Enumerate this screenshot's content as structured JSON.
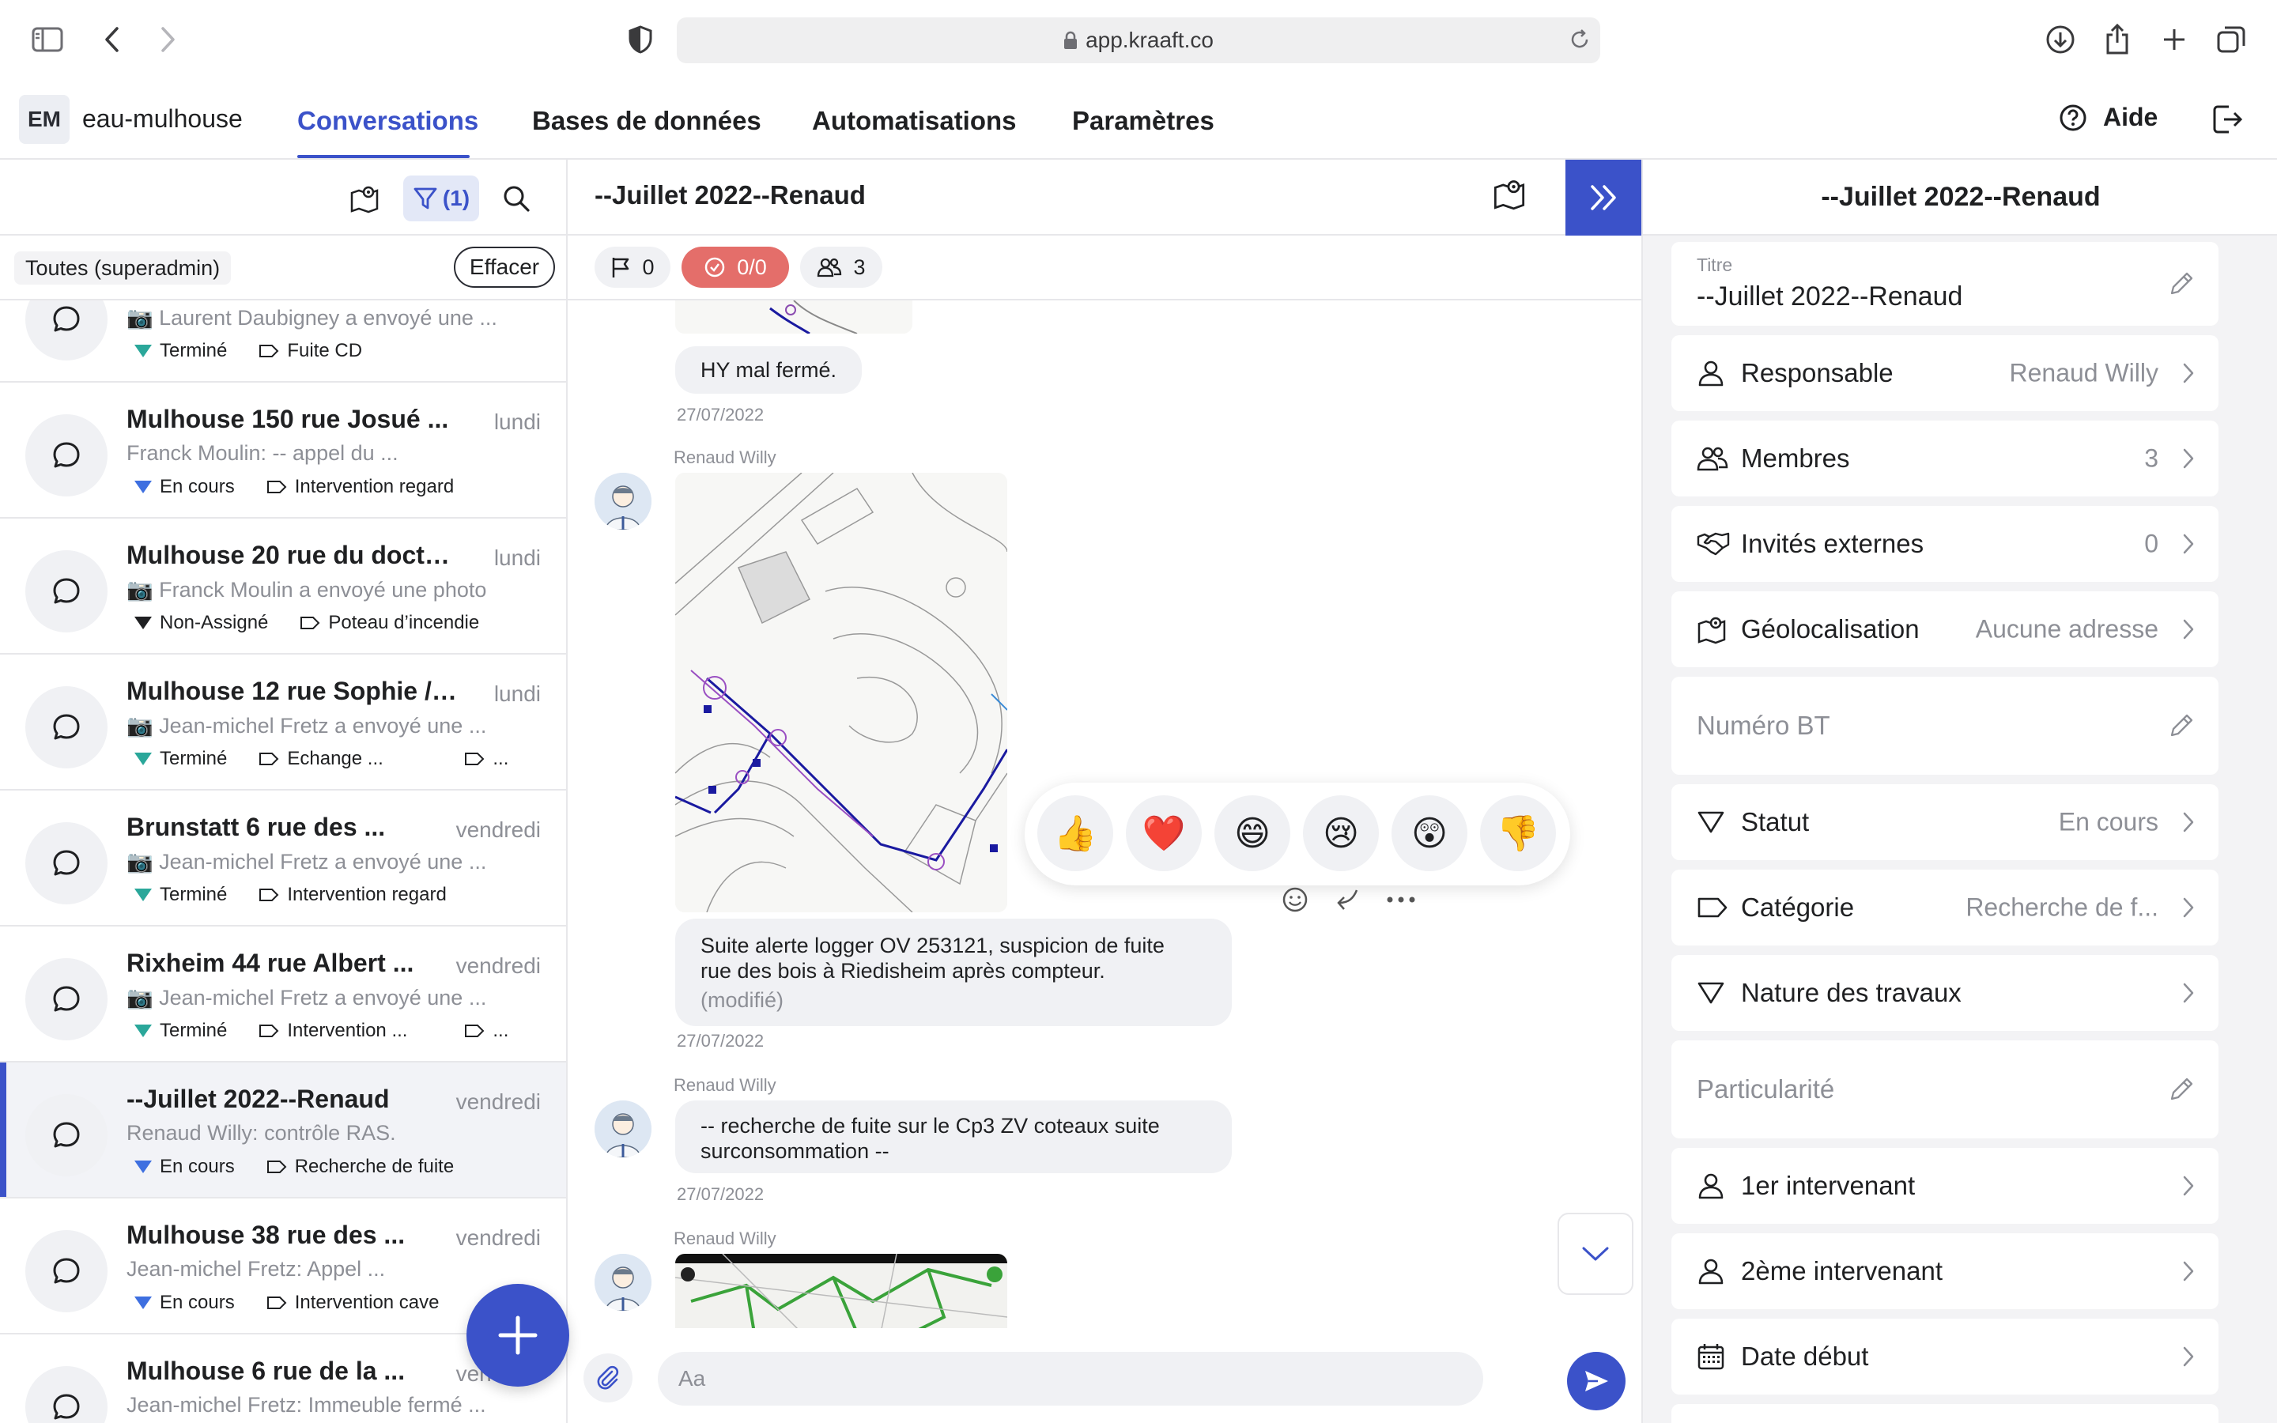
{
  "browser": {
    "url": "app.kraaft.co"
  },
  "nav": {
    "workspace_initials": "EM",
    "workspace_name": "eau-mulhouse",
    "tabs": [
      "Conversations",
      "Bases de données",
      "Automatisations",
      "Paramètres"
    ],
    "active_tab": "Conversations",
    "help_label": "Aide"
  },
  "left": {
    "filter_count": "(1)",
    "filter_label": "Toutes (superadmin)",
    "clear_label": "Effacer",
    "conversations": [
      {
        "title": "",
        "date": "",
        "preview": "📷 Laurent Daubigney a envoyé une ...",
        "status": "Terminé",
        "status_color": "#2aa79a",
        "tags": [
          "Fuite CD"
        ]
      },
      {
        "title": "Mulhouse 150 rue Josué ...",
        "date": "lundi",
        "preview": "Franck Moulin: -- appel du ...",
        "status": "En cours",
        "status_color": "#3e6fe0",
        "tags": [
          "Intervention regard"
        ]
      },
      {
        "title": "Mulhouse 20 rue du docte...",
        "date": "lundi",
        "preview": "📷 Franck Moulin a envoyé une photo",
        "status": "Non-Assigné",
        "status_color": "#1f2022",
        "tags": [
          "Poteau d’incendie"
        ]
      },
      {
        "title": "Mulhouse 12 rue Sophie / ...",
        "date": "lundi",
        "preview": "📷 Jean-michel Fretz a envoyé une ...",
        "status": "Terminé",
        "status_color": "#2aa79a",
        "tags": [
          "Echange ...",
          "..."
        ]
      },
      {
        "title": "Brunstatt 6 rue des ...",
        "date": "vendredi",
        "preview": "📷 Jean-michel Fretz a envoyé une ...",
        "status": "Terminé",
        "status_color": "#2aa79a",
        "tags": [
          "Intervention regard"
        ]
      },
      {
        "title": "Rixheim 44 rue Albert ...",
        "date": "vendredi",
        "preview": "📷 Jean-michel Fretz a envoyé une ...",
        "status": "Terminé",
        "status_color": "#2aa79a",
        "tags": [
          "Intervention ...",
          "..."
        ]
      },
      {
        "title": "--Juillet 2022--Renaud",
        "date": "vendredi",
        "preview": "Renaud Willy: contrôle RAS.",
        "status": "En cours",
        "status_color": "#3e6fe0",
        "tags": [
          "Recherche de fuite"
        ]
      },
      {
        "title": "Mulhouse 38 rue des ...",
        "date": "vendredi",
        "preview": "Jean-michel Fretz: Appel ...",
        "status": "En cours",
        "status_color": "#3e6fe0",
        "tags": [
          "Intervention cave"
        ]
      },
      {
        "title": "Mulhouse 6 rue de la ...",
        "date": "vendredi",
        "preview": "Jean-michel Fretz: Immeuble fermé ...",
        "status": "",
        "status_color": "#3e6fe0",
        "tags": []
      }
    ]
  },
  "mid": {
    "title": "--Juillet 2022--Renaud",
    "chips": {
      "flags": "0",
      "tasks": "0/0",
      "members": "3"
    },
    "messages": {
      "m1_text": "HY mal fermé.",
      "m1_date": "27/07/2022",
      "m2_author": "Renaud Willy",
      "m3_text_1": "Suite alerte logger OV 253121, suspicion de fuite",
      "m3_text_2": "rue des bois à Riedisheim après compteur.",
      "m3_edited": "(modifié)",
      "m3_date": "27/07/2022",
      "m4_author": "Renaud Willy",
      "m4_text_1": "-- recherche de fuite sur le Cp3 ZV coteaux suite",
      "m4_text_2": "surconsommation --",
      "m4_date": "27/07/2022",
      "m5_author": "Renaud Willy"
    },
    "reactions": [
      "👍",
      "❤️",
      "😄",
      "😢",
      "😲",
      "👎"
    ],
    "composer_placeholder": "Aa"
  },
  "right": {
    "header": "--Juillet 2022--Renaud",
    "title_label": "Titre",
    "title_value": "--Juillet 2022--Renaud",
    "fields": {
      "responsable": {
        "label": "Responsable",
        "value": "Renaud Willy"
      },
      "membres": {
        "label": "Membres",
        "value": "3"
      },
      "invites": {
        "label": "Invités externes",
        "value": "0"
      },
      "geo": {
        "label": "Géolocalisation",
        "value": "Aucune adresse"
      },
      "numero_bt": {
        "label": "Numéro BT"
      },
      "statut": {
        "label": "Statut",
        "value": "En cours"
      },
      "categorie": {
        "label": "Catégorie",
        "value": "Recherche de f..."
      },
      "nature": {
        "label": "Nature des travaux",
        "value": ""
      },
      "particularite": {
        "label": "Particularité"
      },
      "intervenant1": {
        "label": "1er intervenant",
        "value": ""
      },
      "intervenant2": {
        "label": "2ème intervenant",
        "value": ""
      },
      "date_debut": {
        "label": "Date début",
        "value": ""
      }
    }
  },
  "colors": {
    "accent": "#3b52c9",
    "task_chip": "#e46e6a",
    "status_done": "#2aa79a",
    "status_in_progress": "#3e6fe0"
  }
}
